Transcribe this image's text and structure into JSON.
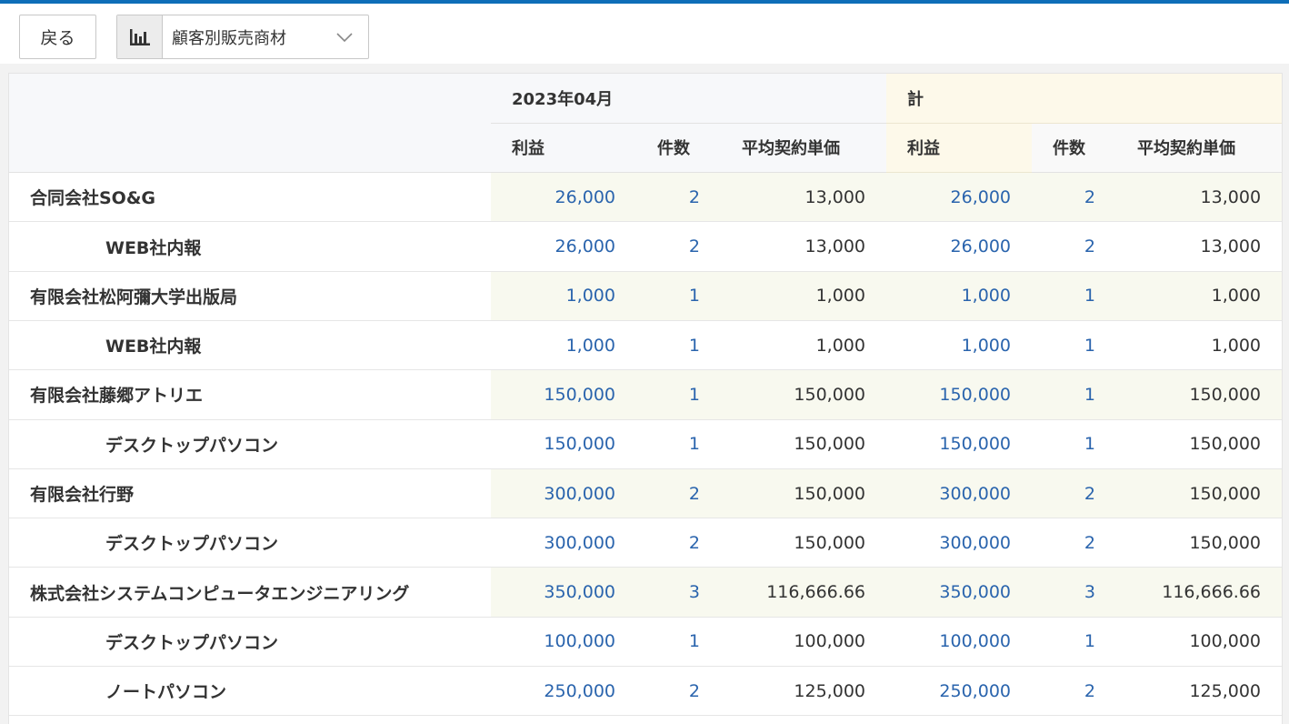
{
  "toolbar": {
    "back_label": "戻る",
    "report_icon": "bar-chart-icon",
    "report_selected": "顧客別販売商材",
    "dropdown_icon": "chevron-down-icon"
  },
  "table": {
    "month_header": "2023年04月",
    "total_header": "計",
    "columns": {
      "profit": "利益",
      "count": "件数",
      "avg_price": "平均契約単価"
    },
    "rows": [
      {
        "type": "parent",
        "name": "合同会社SO&G",
        "m_profit": "26,000",
        "m_count": "2",
        "m_avg": "13,000",
        "t_profit": "26,000",
        "t_count": "2",
        "t_avg": "13,000"
      },
      {
        "type": "sub",
        "name": "WEB社内報",
        "m_profit": "26,000",
        "m_count": "2",
        "m_avg": "13,000",
        "t_profit": "26,000",
        "t_count": "2",
        "t_avg": "13,000"
      },
      {
        "type": "parent",
        "name": "有限会社松阿彌大学出版局",
        "m_profit": "1,000",
        "m_count": "1",
        "m_avg": "1,000",
        "t_profit": "1,000",
        "t_count": "1",
        "t_avg": "1,000"
      },
      {
        "type": "sub",
        "name": "WEB社内報",
        "m_profit": "1,000",
        "m_count": "1",
        "m_avg": "1,000",
        "t_profit": "1,000",
        "t_count": "1",
        "t_avg": "1,000"
      },
      {
        "type": "parent",
        "name": "有限会社藤郷アトリエ",
        "m_profit": "150,000",
        "m_count": "1",
        "m_avg": "150,000",
        "t_profit": "150,000",
        "t_count": "1",
        "t_avg": "150,000"
      },
      {
        "type": "sub",
        "name": "デスクトップパソコン",
        "m_profit": "150,000",
        "m_count": "1",
        "m_avg": "150,000",
        "t_profit": "150,000",
        "t_count": "1",
        "t_avg": "150,000"
      },
      {
        "type": "parent",
        "name": "有限会社行野",
        "m_profit": "300,000",
        "m_count": "2",
        "m_avg": "150,000",
        "t_profit": "300,000",
        "t_count": "2",
        "t_avg": "150,000"
      },
      {
        "type": "sub",
        "name": "デスクトップパソコン",
        "m_profit": "300,000",
        "m_count": "2",
        "m_avg": "150,000",
        "t_profit": "300,000",
        "t_count": "2",
        "t_avg": "150,000"
      },
      {
        "type": "parent",
        "name": "株式会社システムコンピュータエンジニアリング",
        "m_profit": "350,000",
        "m_count": "3",
        "m_avg": "116,666.66",
        "t_profit": "350,000",
        "t_count": "3",
        "t_avg": "116,666.66"
      },
      {
        "type": "sub",
        "name": "デスクトップパソコン",
        "m_profit": "100,000",
        "m_count": "1",
        "m_avg": "100,000",
        "t_profit": "100,000",
        "t_count": "1",
        "t_avg": "100,000"
      },
      {
        "type": "sub",
        "name": "ノートパソコン",
        "m_profit": "250,000",
        "m_count": "2",
        "m_avg": "125,000",
        "t_profit": "250,000",
        "t_count": "2",
        "t_avg": "125,000"
      }
    ]
  }
}
